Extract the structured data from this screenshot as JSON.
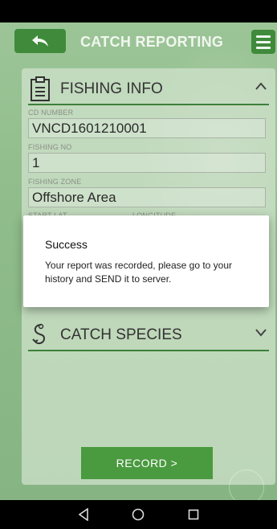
{
  "header": {
    "title": "CATCH REPORTING",
    "icons": {
      "back": "back-arrow-icon",
      "menu": "hamburger-menu-icon"
    }
  },
  "fishing_info": {
    "title": "FISHING INFO",
    "icon": "clipboard-icon",
    "expanded": true,
    "fields": {
      "cd_number": {
        "label": "CD NUMBER",
        "value": "VNCD1601210001"
      },
      "fishing_no": {
        "label": "FISHING NO",
        "value": "1"
      },
      "fishing_zone": {
        "label": "FISHING ZONE",
        "value": "Offshore Area"
      },
      "start_lat_label": "START LAT",
      "longitude_label": "LONGITUDE"
    }
  },
  "catch_species": {
    "title": "CATCH SPECIES",
    "icon": "fish-hook-icon",
    "expanded": false
  },
  "record_button": {
    "label": "RECORD >"
  },
  "dialog": {
    "title": "Success",
    "message": "Your report was recorded, please go to your history and SEND it to server."
  },
  "nav": {
    "icons": [
      "back-triangle-icon",
      "home-circle-icon",
      "recents-square-icon"
    ]
  },
  "colors": {
    "primary_green": "#3f8a3b",
    "button_green": "#4a9a3f",
    "section_line": "#3e7f3a"
  }
}
